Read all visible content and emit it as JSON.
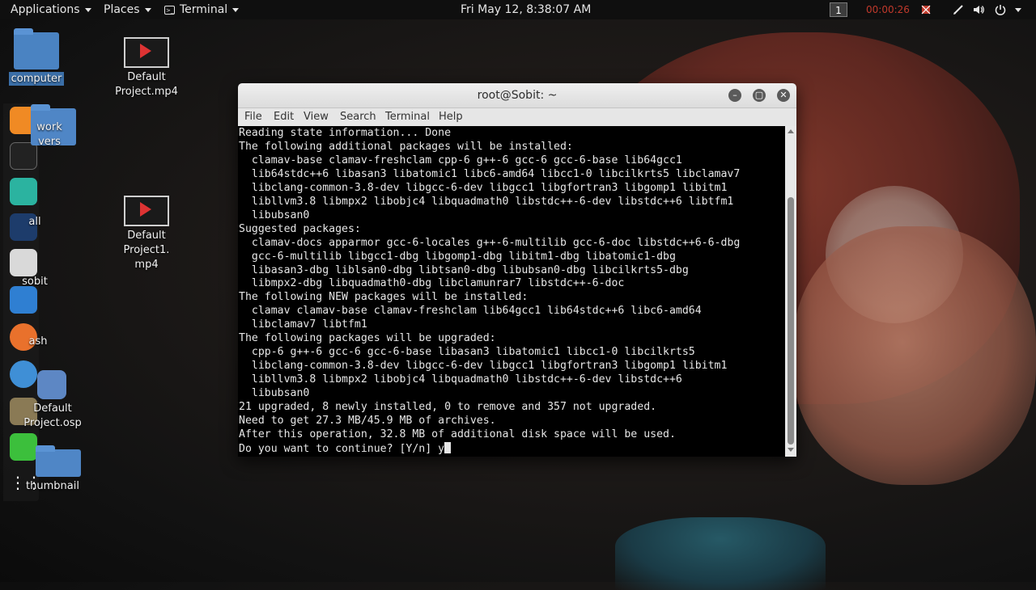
{
  "topbar": {
    "applications": "Applications",
    "places": "Places",
    "terminal": "Terminal",
    "clock": "Fri May 12,  8:38:07 AM",
    "workspace": "1",
    "recording_time": "00:00:26"
  },
  "desktop_icons": [
    {
      "label": "computer",
      "icon": "home-folder-icon"
    },
    {
      "label": "Default Project.mp4",
      "icon": "video-file-icon"
    },
    {
      "label": "work\nvers",
      "icon": "folder-icon"
    },
    {
      "label": "Default Project1.\nmp4",
      "icon": "video-file-icon"
    },
    {
      "label": "all",
      "icon": "folder-icon"
    },
    {
      "label": "sobit",
      "icon": "folder-icon"
    },
    {
      "label": "ash",
      "icon": "trash-icon"
    },
    {
      "label": "Default\nProject.osp",
      "icon": "openshot-project-icon"
    },
    {
      "label": "thumbnail",
      "icon": "folder-icon"
    }
  ],
  "terminal": {
    "title": "root@Sobit: ~",
    "menu": [
      "File",
      "Edit",
      "View",
      "Search",
      "Terminal",
      "Help"
    ],
    "lines": [
      "Reading state information... Done",
      "The following additional packages will be installed:",
      "  clamav-base clamav-freshclam cpp-6 g++-6 gcc-6 gcc-6-base lib64gcc1",
      "  lib64stdc++6 libasan3 libatomic1 libc6-amd64 libcc1-0 libcilkrts5 libclamav7",
      "  libclang-common-3.8-dev libgcc-6-dev libgcc1 libgfortran3 libgomp1 libitm1",
      "  libllvm3.8 libmpx2 libobjc4 libquadmath0 libstdc++-6-dev libstdc++6 libtfm1",
      "  libubsan0",
      "Suggested packages:",
      "  clamav-docs apparmor gcc-6-locales g++-6-multilib gcc-6-doc libstdc++6-6-dbg",
      "  gcc-6-multilib libgcc1-dbg libgomp1-dbg libitm1-dbg libatomic1-dbg",
      "  libasan3-dbg liblsan0-dbg libtsan0-dbg libubsan0-dbg libcilkrts5-dbg",
      "  libmpx2-dbg libquadmath0-dbg libclamunrar7 libstdc++-6-doc",
      "The following NEW packages will be installed:",
      "  clamav clamav-base clamav-freshclam lib64gcc1 lib64stdc++6 libc6-amd64",
      "  libclamav7 libtfm1",
      "The following packages will be upgraded:",
      "  cpp-6 g++-6 gcc-6 gcc-6-base libasan3 libatomic1 libcc1-0 libcilkrts5",
      "  libclang-common-3.8-dev libgcc-6-dev libgcc1 libgfortran3 libgomp1 libitm1",
      "  libllvm3.8 libmpx2 libobjc4 libquadmath0 libstdc++-6-dev libstdc++6",
      "  libubsan0",
      "21 upgraded, 8 newly installed, 0 to remove and 357 not upgraded.",
      "Need to get 27.3 MB/45.9 MB of archives.",
      "After this operation, 32.8 MB of additional disk space will be used."
    ],
    "prompt_line": "Do you want to continue? [Y/n] y"
  },
  "colors": {
    "terminal_bg": "#000000",
    "terminal_fg": "#e6e6e6",
    "topbar_bg": "#0f0f0f",
    "record_red": "#c0392b"
  }
}
